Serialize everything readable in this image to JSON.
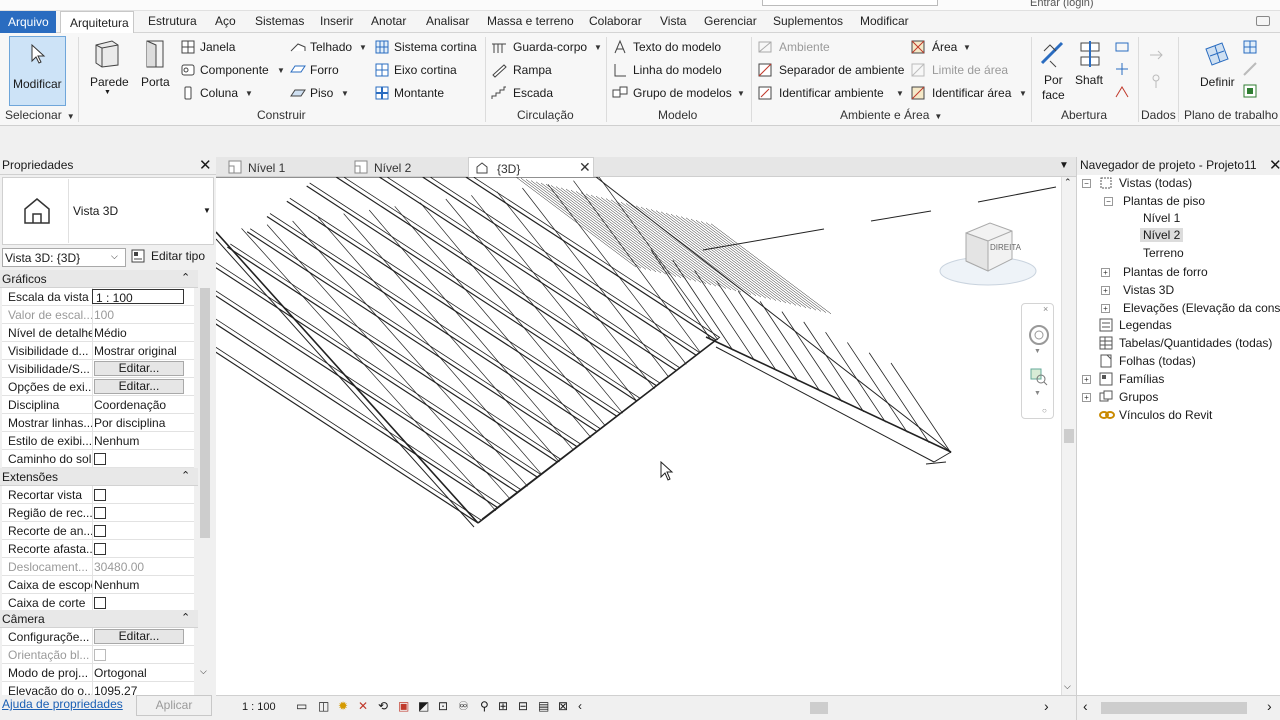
{
  "menu": {
    "items": [
      "Arquivo",
      "Arquitetura",
      "Estrutura",
      "Aço",
      "Sistemas",
      "Inserir",
      "Anotar",
      "Analisar",
      "Massa e terreno",
      "Colaborar",
      "Vista",
      "Gerenciar",
      "Suplementos",
      "Modificar"
    ]
  },
  "title_strip": {
    "user": "Entrar (login)"
  },
  "ribbon": {
    "modificar": "Modificar",
    "parede": "Parede",
    "porta": "Porta",
    "janela": "Janela",
    "componente": "Componente",
    "coluna": "Coluna",
    "telhado": "Telhado",
    "forro": "Forro",
    "piso": "Piso",
    "sistema_cortina": "Sistema cortina",
    "eixo_cortina": "Eixo cortina",
    "montante": "Montante",
    "guarda_corpo": "Guarda-corpo",
    "rampa": "Rampa",
    "escada": "Escada",
    "texto_modelo": "Texto do modelo",
    "linha_modelo": "Linha do modelo",
    "grupo_modelos": "Grupo de modelos",
    "ambiente": "Ambiente",
    "separador_ambiente": "Separador de ambiente",
    "identificar_ambiente": "Identificar ambiente",
    "area": "Área",
    "limite_area": "Limite de área",
    "identificar_area": "Identificar área",
    "por": "Por",
    "face": "face",
    "shaft": "Shaft",
    "definir": "Definir",
    "panels": {
      "selecionar": "Selecionar",
      "construir": "Construir",
      "circulacao": "Circulação",
      "modelo": "Modelo",
      "ambiente_area": "Ambiente e Área",
      "abertura": "Abertura",
      "dados": "Dados",
      "plano": "Plano de trabalho"
    }
  },
  "properties": {
    "title": "Propriedades",
    "type_name": "Vista 3D",
    "selector": "Vista 3D: {3D}",
    "edit_type": "Editar tipo",
    "sections": {
      "graficos": "Gráficos",
      "extensoes": "Extensões",
      "camera": "Câmera"
    },
    "graficos": [
      {
        "k": "Escala da vista",
        "v": "1 : 100"
      },
      {
        "k": "Valor de escal...",
        "v": "100"
      },
      {
        "k": "Nível de detalhe",
        "v": "Médio"
      },
      {
        "k": "Visibilidade d...",
        "v": "Mostrar original"
      },
      {
        "k": "Visibilidade/S...",
        "v": "Editar..."
      },
      {
        "k": "Opções de exi...",
        "v": "Editar..."
      },
      {
        "k": "Disciplina",
        "v": "Coordenação"
      },
      {
        "k": "Mostrar linhas...",
        "v": "Por disciplina"
      },
      {
        "k": "Estilo de exibi...",
        "v": "Nenhum"
      },
      {
        "k": "Caminho do sol",
        "v": ""
      }
    ],
    "extensoes": [
      {
        "k": "Recortar vista",
        "v": ""
      },
      {
        "k": "Região de rec...",
        "v": ""
      },
      {
        "k": "Recorte de an...",
        "v": ""
      },
      {
        "k": "Recorte afasta...",
        "v": ""
      },
      {
        "k": "Deslocament...",
        "v": "30480.00"
      },
      {
        "k": "Caixa de escopo",
        "v": "Nenhum"
      },
      {
        "k": "Caixa de corte",
        "v": ""
      }
    ],
    "camera": [
      {
        "k": "Configuraçõe...",
        "v": "Editar..."
      },
      {
        "k": "Orientação bl...",
        "v": ""
      },
      {
        "k": "Modo de proj...",
        "v": "Ortogonal"
      },
      {
        "k": "Elevação do o...",
        "v": "1095.27"
      }
    ],
    "help_link": "Ajuda de propriedades",
    "apply": "Aplicar"
  },
  "view": {
    "tabs": [
      "Nível 1",
      "Nível 2",
      "{3D}"
    ],
    "scale": "1 : 100",
    "viewcube_label": "DIREITA"
  },
  "browser": {
    "title": "Navegador de projeto - Projeto11",
    "items": {
      "vistas": "Vistas (todas)",
      "plantas_piso": "Plantas de piso",
      "nivel1": "Nível 1",
      "nivel2": "Nível 2",
      "terreno": "Terreno",
      "plantas_forro": "Plantas de forro",
      "vistas3d": "Vistas 3D",
      "elevacoes": "Elevações (Elevação da constr",
      "legendas": "Legendas",
      "tabelas": "Tabelas/Quantidades (todas)",
      "folhas": "Folhas (todas)",
      "familias": "Famílias",
      "grupos": "Grupos",
      "vinculos": "Vínculos do Revit"
    }
  },
  "colors": {
    "accent": "#2a6cc0",
    "selected_tool": "#cde3f7",
    "selected_tree": "#dcdcdc"
  }
}
